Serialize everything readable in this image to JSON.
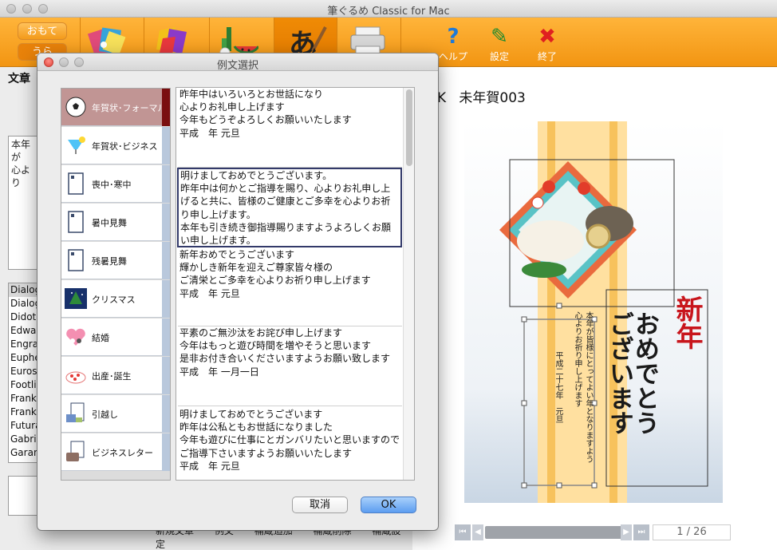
{
  "app": {
    "title": "筆ぐるめ Classic for Mac"
  },
  "toolbar": {
    "side_front": "おもて",
    "side_back": "うら",
    "help_label": "ヘルプ",
    "settings_label": "設定",
    "quit_label": "終了"
  },
  "left_panel": {
    "section_label": "文章",
    "text_preview": "本年が\n心より",
    "fonts": [
      "Dialog",
      "Dialog",
      "Didot",
      "Edwar",
      "Engra",
      "Euphe",
      "Euros",
      "Footli",
      "Frank",
      "Frank",
      "Futura",
      "Gabri",
      "Garam"
    ],
    "bottom_actions": [
      "新規文章",
      "例文",
      "補蔵追加",
      "補蔵削除",
      "補蔵設定"
    ]
  },
  "preview": {
    "card_title_prefix": "K",
    "card_title": "未年賀003",
    "greeting_big": "新年",
    "greeting_main": "おめでとう\nございます",
    "greeting_text": "本年が皆様にとってよい年となりますよう\n心よりお祈り申し上げます",
    "date_text": "平成二十七年　元旦",
    "page_indicator": "1 / 26"
  },
  "dialog": {
    "title": "例文選択",
    "categories": [
      {
        "label": "年賀状･フォーマル",
        "icon": "soccer-ball-icon",
        "selected": true
      },
      {
        "label": "年賀状･ビジネス",
        "icon": "tropical-drink-icon",
        "selected": false
      },
      {
        "label": "喪中･寒中",
        "icon": "postcard-icon",
        "selected": false
      },
      {
        "label": "暑中見舞",
        "icon": "postcard-icon",
        "selected": false
      },
      {
        "label": "残暑見舞",
        "icon": "postcard-icon",
        "selected": false
      },
      {
        "label": "クリスマス",
        "icon": "christmas-tree-icon",
        "selected": false
      },
      {
        "label": "結婚",
        "icon": "wedding-couple-icon",
        "selected": false
      },
      {
        "label": "出産･誕生",
        "icon": "birthday-cake-icon",
        "selected": false
      },
      {
        "label": "引越し",
        "icon": "moving-house-icon",
        "selected": false
      },
      {
        "label": "ビジネスレター",
        "icon": "briefcase-icon",
        "selected": false
      }
    ],
    "examples": [
      {
        "text": "昨年中はいろいろとお世話になり\n心よりお礼申し上げます\n今年もどうぞよろしくお願いいたします\n 平成　年 元旦",
        "selected": false
      },
      {
        "text": "明けましておめでとうございます。\n昨年中は何かとご指導を賜り、心よりお礼申し上げると共に、皆様のご健康とご多幸を心よりお祈り申し上げます。\n本年も引き続き御指導賜りますようよろしくお願い申し上げます。",
        "selected": true
      },
      {
        "text": "新年おめでとうございます\n輝かしき新年を迎えご尊家皆々様の\nご清栄とご多幸を心よりお祈り申し上げます\n 平成　年 元旦",
        "selected": false
      },
      {
        "text": "平素のご無沙汰をお詫び申し上げます\n今年はもっと遊び時間を増やそうと思います\n是非お付き合いくださいますようお願い致します\n 平成　年 一月一日",
        "selected": false
      },
      {
        "text": "明けましておめでとうございます\n昨年は公私ともお世話になりました\n今年も遊びに仕事にとガンバリたいと思いますので\nご指導下さいますようお願いいたします\n 平成　年 元旦",
        "selected": false
      }
    ],
    "cancel_label": "取消",
    "ok_label": "OK"
  }
}
